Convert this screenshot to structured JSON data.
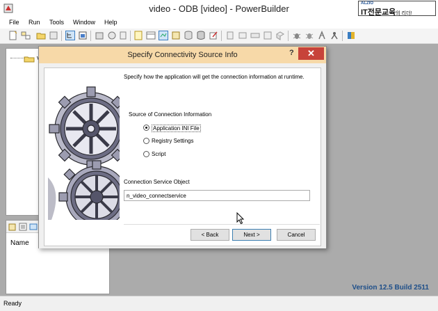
{
  "window": {
    "title": "video - ODB [video]  - PowerBuilder"
  },
  "brand": {
    "small": "ALZIO",
    "main": "IT전문교육",
    "sub": "의 리더!"
  },
  "menu": {
    "items": [
      "File",
      "Run",
      "Tools",
      "Window",
      "Help"
    ]
  },
  "toolbar": {
    "icons": [
      "new-icon",
      "inherit-icon",
      "open-icon",
      "print-icon",
      "system-tree-icon",
      "output-icon",
      "library-icon",
      "browser-icon",
      "clip-icon",
      "application-icon",
      "datawindow-icon",
      "database-icon",
      "database-painter-icon",
      "db-profile-icon",
      "edit-icon",
      "deploy-icon",
      "build-icon",
      "project-icon",
      "window-icon",
      "menu-icon",
      "structure-icon",
      "debug-icon",
      "debug-stop-icon",
      "run-icon",
      "select-run-icon",
      "exit-icon"
    ]
  },
  "tree": {
    "item_label": "vid"
  },
  "output_panel": {
    "column_header": "Name"
  },
  "version": "Version 12.5 Build 2511",
  "status": {
    "text": "Ready"
  },
  "dialog": {
    "title": "Specify Connectivity Source Info",
    "help": "?",
    "close": "✕",
    "description": "Specify how the application will get the connection information at runtime.",
    "group_label": "Source of Connection Information",
    "options": [
      {
        "label": "Application INI File",
        "selected": true
      },
      {
        "label": "Registry Settings",
        "selected": false
      },
      {
        "label": "Script",
        "selected": false
      }
    ],
    "field_label": "Connection Service Object",
    "field_value": "n_video_connectservice",
    "buttons": {
      "back": "< Back",
      "next": "Next >",
      "cancel": "Cancel"
    }
  },
  "colors": {
    "dialog_title_bg": "#f7d9a8",
    "close_bg": "#c7433a",
    "workspace_bg": "#ababab",
    "version_text": "#1d4e89"
  }
}
